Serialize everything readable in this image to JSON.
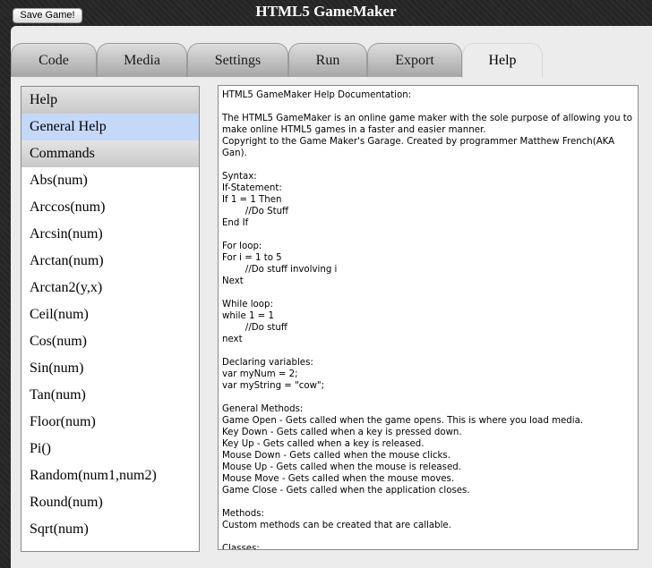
{
  "window": {
    "title": "HTML5 GameMaker",
    "save_button_label": "Save Game!"
  },
  "tabs": [
    {
      "label": "Code"
    },
    {
      "label": "Media"
    },
    {
      "label": "Settings"
    },
    {
      "label": "Run"
    },
    {
      "label": "Export"
    },
    {
      "label": "Help",
      "active": true
    }
  ],
  "sidebar": {
    "items": [
      {
        "label": "Help",
        "type": "header"
      },
      {
        "label": "General Help",
        "selected": true
      },
      {
        "label": "Commands",
        "type": "header"
      },
      {
        "label": "Abs(num)"
      },
      {
        "label": "Arccos(num)"
      },
      {
        "label": "Arcsin(num)"
      },
      {
        "label": "Arctan(num)"
      },
      {
        "label": "Arctan2(y,x)"
      },
      {
        "label": "Ceil(num)"
      },
      {
        "label": "Cos(num)"
      },
      {
        "label": "Sin(num)"
      },
      {
        "label": "Tan(num)"
      },
      {
        "label": "Floor(num)"
      },
      {
        "label": "Pi()"
      },
      {
        "label": "Random(num1,num2)"
      },
      {
        "label": "Round(num)"
      },
      {
        "label": "Sqrt(num)"
      }
    ]
  },
  "doc": {
    "text": "HTML5 GameMaker Help Documentation:\n\nThe HTML5 GameMaker is an online game maker with the sole purpose of allowing you to make online HTML5 games in a faster and easier manner.\nCopyright to the Game Maker's Garage. Created by programmer Matthew French(AKA Gan).\n\nSyntax:\nIf-Statement:\nIf 1 = 1 Then\n        //Do Stuff\nEnd If\n\nFor loop:\nFor i = 1 to 5\n        //Do stuff involving i\nNext\n\nWhile loop:\nwhile 1 = 1\n        //Do stuff\nnext\n\nDeclaring variables:\nvar myNum = 2;\nvar myString = \"cow\";\n\nGeneral Methods:\nGame Open - Gets called when the game opens. This is where you load media.\nKey Down - Gets called when a key is pressed down.\nKey Up - Gets called when a key is released.\nMouse Down - Gets called when the mouse clicks.\nMouse Up - Gets called when the mouse is released.\nMouse Move - Gets called when the mouse moves.\nGame Close - Gets called when the application closes.\n\nMethods:\nCustom methods can be created that are callable.\n\nClasses:"
  }
}
